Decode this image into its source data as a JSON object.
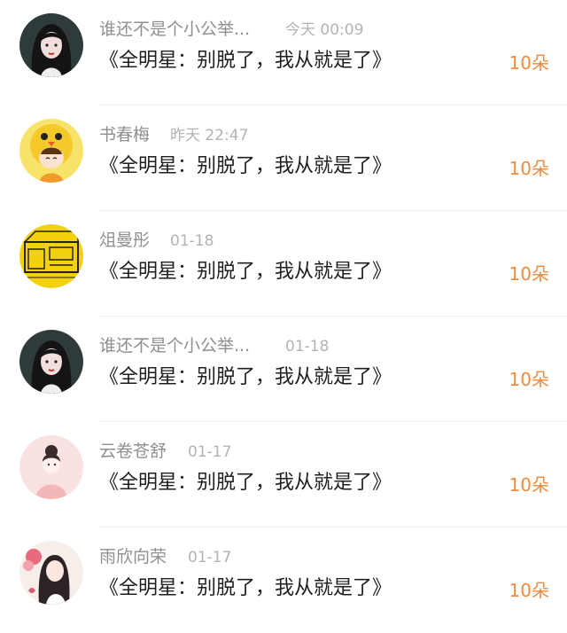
{
  "records": [
    {
      "name": "谁还不是个小公举...",
      "time": "今天 00:09",
      "message": "《全明星：别脱了，我从就是了》",
      "gift": "10朵",
      "avatar_icon": "dark-haired-girl-avatar"
    },
    {
      "name": "书春梅",
      "time": "昨天 22:47",
      "message": "《全明星：别脱了，我从就是了》",
      "gift": "10朵",
      "avatar_icon": "chick-hat-boy-avatar"
    },
    {
      "name": "俎曼彤",
      "time": "01-18",
      "message": "《全明星：别脱了，我从就是了》",
      "gift": "10朵",
      "avatar_icon": "yellow-sketch-avatar"
    },
    {
      "name": "谁还不是个小公举...",
      "time": "01-18",
      "message": "《全明星：别脱了，我从就是了》",
      "gift": "10朵",
      "avatar_icon": "dark-haired-girl-avatar"
    },
    {
      "name": "云卷苍舒",
      "time": "01-17",
      "message": "《全明星：别脱了，我从就是了》",
      "gift": "10朵",
      "avatar_icon": "pink-girl-avatar"
    },
    {
      "name": "雨欣向荣",
      "time": "01-17",
      "message": "《全明星：别脱了，我从就是了》",
      "gift": "10朵",
      "avatar_icon": "floral-girl-avatar"
    }
  ],
  "colors": {
    "gift": "#f08a3c",
    "name": "#8f8f8f",
    "time": "#b3b3b3",
    "message": "#1f1f1f"
  }
}
